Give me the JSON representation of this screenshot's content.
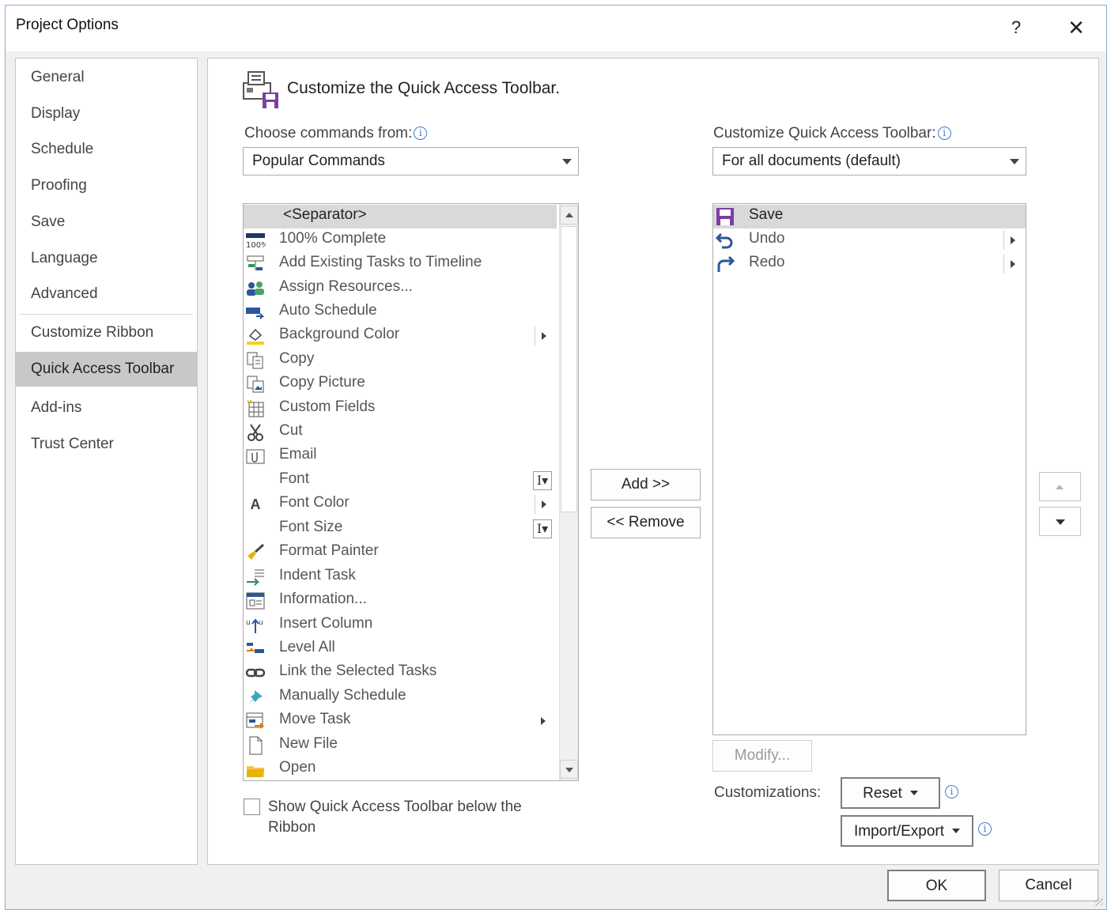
{
  "window": {
    "title": "Project Options",
    "help_glyph": "?",
    "close_glyph": "✕"
  },
  "nav": {
    "items": [
      {
        "label": "General"
      },
      {
        "label": "Display"
      },
      {
        "label": "Schedule"
      },
      {
        "label": "Proofing"
      },
      {
        "label": "Save"
      },
      {
        "label": "Language"
      },
      {
        "label": "Advanced"
      },
      {
        "label": "Customize Ribbon"
      },
      {
        "label": "Quick Access Toolbar",
        "selected": true
      },
      {
        "label": "Add-ins"
      },
      {
        "label": "Trust Center"
      }
    ]
  },
  "main": {
    "header_title": "Customize the Quick Access Toolbar.",
    "choose_from_label": "Choose commands from:",
    "choose_from_value": "Popular Commands",
    "customize_label": "Customize Quick Access Toolbar:",
    "customize_value": "For all documents (default)",
    "info_glyph": "i",
    "commands": [
      {
        "label": "<Separator>",
        "icon": "separator",
        "selected": true
      },
      {
        "label": "100% Complete",
        "icon": "complete-100-icon"
      },
      {
        "label": "Add Existing Tasks to Timeline",
        "icon": "timeline-add-icon"
      },
      {
        "label": "Assign Resources...",
        "icon": "assign-resources-icon"
      },
      {
        "label": "Auto Schedule",
        "icon": "auto-schedule-icon"
      },
      {
        "label": "Background Color",
        "icon": "paint-bucket-icon",
        "submenu": true
      },
      {
        "label": "Copy",
        "icon": "copy-icon"
      },
      {
        "label": "Copy Picture",
        "icon": "copy-picture-icon"
      },
      {
        "label": "Custom Fields",
        "icon": "custom-fields-icon"
      },
      {
        "label": "Cut",
        "icon": "scissors-icon"
      },
      {
        "label": "Email",
        "icon": "email-icon"
      },
      {
        "label": "Font",
        "icon": "",
        "split": true
      },
      {
        "label": "Font Color",
        "icon": "font-color-icon",
        "submenu": true
      },
      {
        "label": "Font Size",
        "icon": "",
        "split": true
      },
      {
        "label": "Format Painter",
        "icon": "format-painter-icon"
      },
      {
        "label": "Indent Task",
        "icon": "indent-icon"
      },
      {
        "label": "Information...",
        "icon": "information-icon"
      },
      {
        "label": "Insert Column",
        "icon": "insert-column-icon"
      },
      {
        "label": "Level All",
        "icon": "level-all-icon"
      },
      {
        "label": "Link the Selected Tasks",
        "icon": "link-icon"
      },
      {
        "label": "Manually Schedule",
        "icon": "pin-icon"
      },
      {
        "label": "Move Task",
        "icon": "move-task-icon",
        "submenu": true
      },
      {
        "label": "New File",
        "icon": "new-file-icon"
      },
      {
        "label": "Open",
        "icon": "folder-icon"
      }
    ],
    "qat_items": [
      {
        "label": "Save",
        "icon": "save-icon",
        "selected": true
      },
      {
        "label": "Undo",
        "icon": "undo-icon",
        "submenu": true
      },
      {
        "label": "Redo",
        "icon": "redo-icon",
        "submenu": true
      }
    ],
    "add_button": "Add >>",
    "remove_button": "<< Remove",
    "modify_button": "Modify...",
    "customizations_label": "Customizations:",
    "reset_button": "Reset",
    "import_export_button": "Import/Export",
    "show_below_label": "Show Quick Access Toolbar below the Ribbon"
  },
  "footer": {
    "ok": "OK",
    "cancel": "Cancel"
  },
  "colors": {
    "selected_nav": "#c8c8c8",
    "selected_row": "#d9d9d9",
    "accent_blue": "#2b579a",
    "info_blue": "#3f7ad1",
    "save_purple": "#7b3fa1"
  }
}
